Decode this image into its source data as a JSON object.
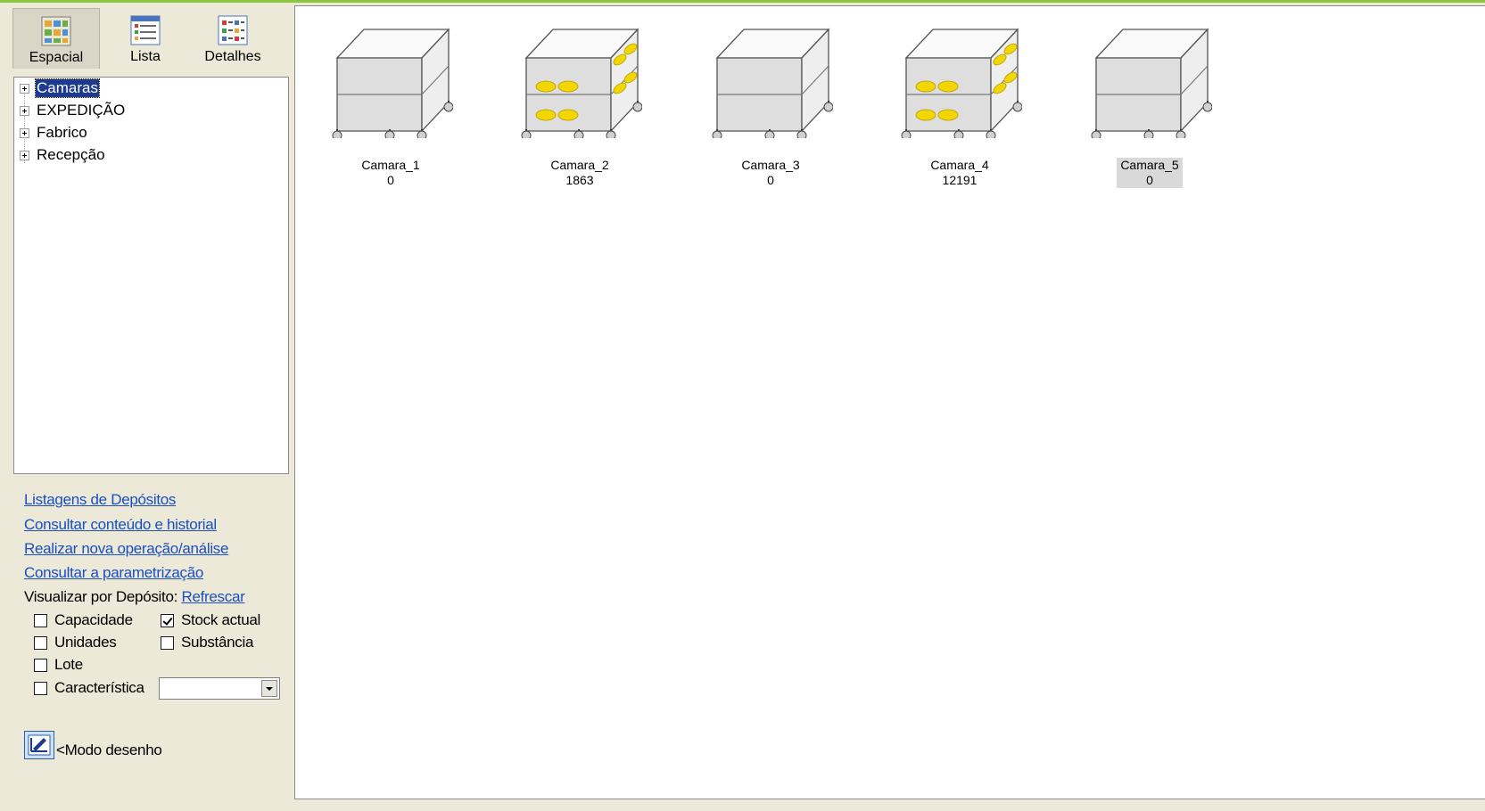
{
  "view_buttons": [
    {
      "label": "Espacial",
      "icon": "spatial-view-icon",
      "active": true
    },
    {
      "label": "Lista",
      "icon": "list-view-icon",
      "active": false
    },
    {
      "label": "Detalhes",
      "icon": "details-view-icon",
      "active": false
    }
  ],
  "tree": {
    "items": [
      {
        "label": "Camaras",
        "selected": true
      },
      {
        "label": "EXPEDIÇÃO",
        "selected": false
      },
      {
        "label": "Fabrico",
        "selected": false
      },
      {
        "label": "Recepção",
        "selected": false
      }
    ]
  },
  "links": {
    "listagens": "Listagens de Depósitos",
    "consultar_conteudo": "Consultar conteúdo e historial",
    "realizar_operacao": "Realizar nova operação/análise",
    "consultar_param": "Consultar a parametrização"
  },
  "visualizar": {
    "label": "Visualizar por Depósito:",
    "refresh": "Refrescar"
  },
  "options": {
    "capacidade": {
      "label": "Capacidade",
      "checked": false
    },
    "stock_actual": {
      "label": "Stock actual",
      "checked": true
    },
    "unidades": {
      "label": "Unidades",
      "checked": false
    },
    "substancia": {
      "label": "Substância",
      "checked": false
    },
    "lote": {
      "label": "Lote",
      "checked": false
    },
    "caracteristica": {
      "label": "Característica",
      "checked": false,
      "value": ""
    }
  },
  "draw_mode": {
    "label": "<Modo desenho",
    "icon": "draw-mode-icon"
  },
  "chambers": [
    {
      "name": "Camara_1",
      "value": "0",
      "filled": false,
      "selected": false
    },
    {
      "name": "Camara_2",
      "value": "1863",
      "filled": true,
      "selected": false
    },
    {
      "name": "Camara_3",
      "value": "0",
      "filled": false,
      "selected": false
    },
    {
      "name": "Camara_4",
      "value": "12191",
      "filled": true,
      "selected": false
    },
    {
      "name": "Camara_5",
      "value": "0",
      "filled": false,
      "selected": true
    }
  ],
  "colors": {
    "accent_line": "#8cc63f",
    "link": "#1a4fbf",
    "selection": "#1c3a8f",
    "cheese": "#f2d600"
  }
}
